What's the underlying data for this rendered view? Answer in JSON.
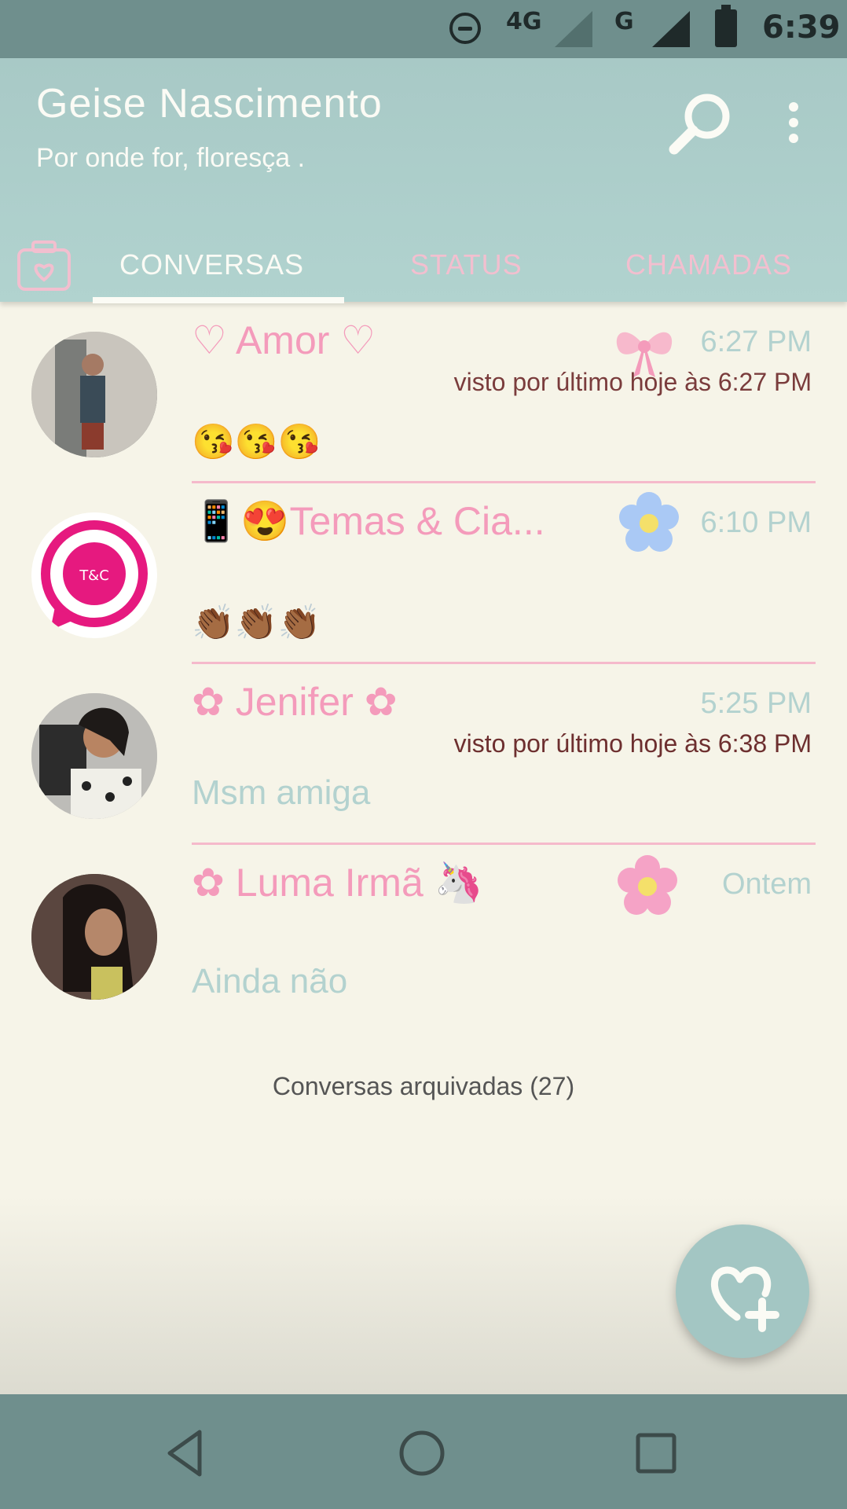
{
  "status_bar": {
    "network": "4G",
    "network2": "G",
    "time": "6:39"
  },
  "header": {
    "title": "Geise Nascimento",
    "subtitle": "Por onde for, floresça ."
  },
  "tabs": [
    {
      "label": "CONVERSAS",
      "active": true
    },
    {
      "label": "STATUS",
      "active": false
    },
    {
      "label": "CHAMADAS",
      "active": false
    }
  ],
  "chats": [
    {
      "name": "♡ Amor ♡",
      "time": "6:27 PM",
      "last_seen": "visto por último hoje às 6:27 PM",
      "message": "😘😘😘",
      "deco": "bow-icon"
    },
    {
      "name": "📱😍Temas & Cia...",
      "time": "6:10 PM",
      "last_seen": "",
      "message": "👏🏾👏🏾👏🏾",
      "deco": "blue-flower-icon"
    },
    {
      "name": "✿ Jenifer ✿",
      "time": "5:25 PM",
      "last_seen": "visto por último hoje às 6:38 PM",
      "message": "Msm amiga",
      "deco": ""
    },
    {
      "name": "✿ Luma Irmã 🦄",
      "time": "Ontem",
      "last_seen": "",
      "message": "Ainda não",
      "deco": "pink-flower-icon"
    }
  ],
  "archived": "Conversas arquivadas (27)",
  "colors": {
    "header": "#b1d3cf",
    "background": "#f6f4e8",
    "accent_pink": "#f49bbb",
    "accent_teal": "#b3d2cf"
  }
}
